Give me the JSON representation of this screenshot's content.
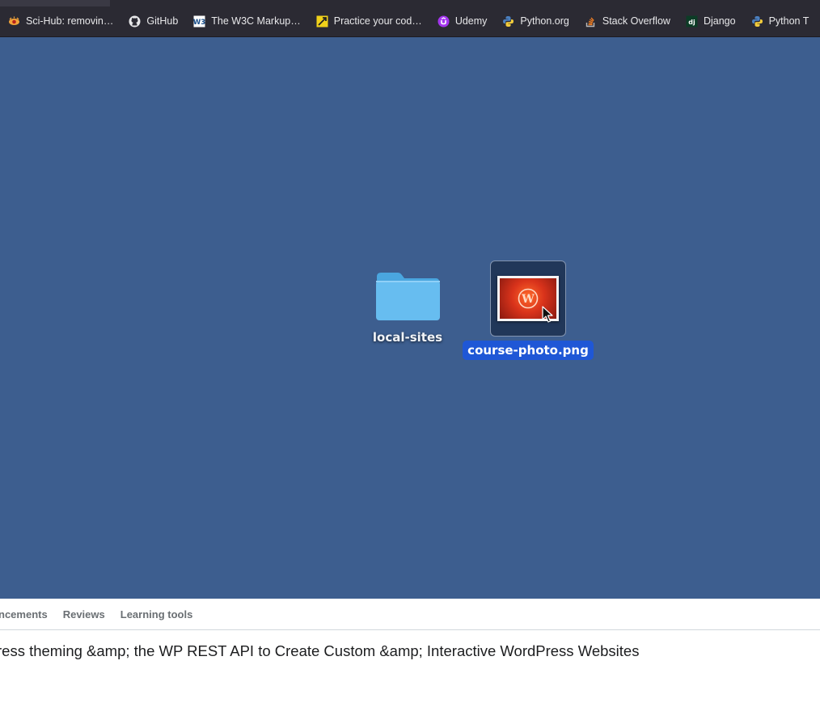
{
  "bookmarks": [
    {
      "label": "Sci-Hub: removin…",
      "icon": "scihub-icon"
    },
    {
      "label": "GitHub",
      "icon": "github-icon"
    },
    {
      "label": "The W3C Markup…",
      "icon": "w3c-icon"
    },
    {
      "label": "Practice your cod…",
      "icon": "codewars-icon"
    },
    {
      "label": "Udemy",
      "icon": "udemy-icon"
    },
    {
      "label": "Python.org",
      "icon": "python-icon"
    },
    {
      "label": "Stack Overflow",
      "icon": "stackoverflow-icon"
    },
    {
      "label": "Django",
      "icon": "django-icon"
    },
    {
      "label": "Python T",
      "icon": "python-icon"
    }
  ],
  "desktop": {
    "folder_label": "local-sites",
    "file_label": "course-photo.png"
  },
  "course_tabs": [
    {
      "label": "ncements"
    },
    {
      "label": "Reviews"
    },
    {
      "label": "Learning tools"
    }
  ],
  "course_title": "ress theming &amp; the WP REST API to Create Custom &amp; Interactive WordPress Websites",
  "colors": {
    "desktop_bg": "#3d5e8f",
    "selection_blue": "#1f57d6",
    "browser_chrome": "#2b2a33"
  }
}
